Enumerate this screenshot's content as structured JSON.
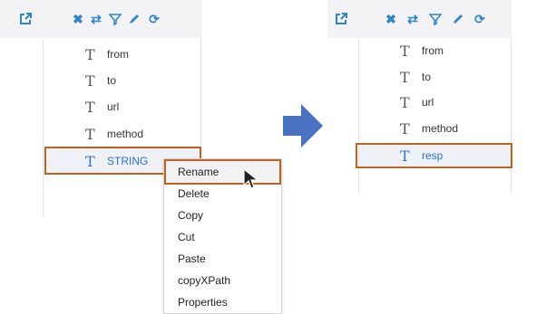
{
  "left_panel": {
    "toolbar": {
      "icons": [
        "open-external-icon",
        "close-icon",
        "shuffle-icon",
        "filter-icon",
        "edit-icon",
        "refresh-icon"
      ]
    },
    "tree": {
      "items": [
        {
          "label": "from"
        },
        {
          "label": "to"
        },
        {
          "label": "url"
        },
        {
          "label": "method"
        },
        {
          "label": "STRING",
          "selected": true
        }
      ]
    }
  },
  "context_menu": {
    "items": [
      {
        "label": "Rename",
        "hover": true
      },
      {
        "label": "Delete"
      },
      {
        "label": "Copy"
      },
      {
        "label": "Cut"
      },
      {
        "label": "Paste"
      },
      {
        "label": "copyXPath"
      },
      {
        "label": "Properties"
      }
    ]
  },
  "right_panel": {
    "toolbar": {
      "icons": [
        "open-external-icon",
        "close-icon",
        "shuffle-icon",
        "filter-icon",
        "edit-icon",
        "refresh-icon"
      ]
    },
    "tree": {
      "items": [
        {
          "label": "from"
        },
        {
          "label": "to"
        },
        {
          "label": "url"
        },
        {
          "label": "method"
        },
        {
          "label": "resp",
          "selected": true
        }
      ]
    }
  },
  "colors": {
    "accent": "#2f86c9",
    "highlight_border": "#c0621f",
    "arrow": "#4a72c4",
    "toolbar_bg": "#f3f3f5"
  }
}
